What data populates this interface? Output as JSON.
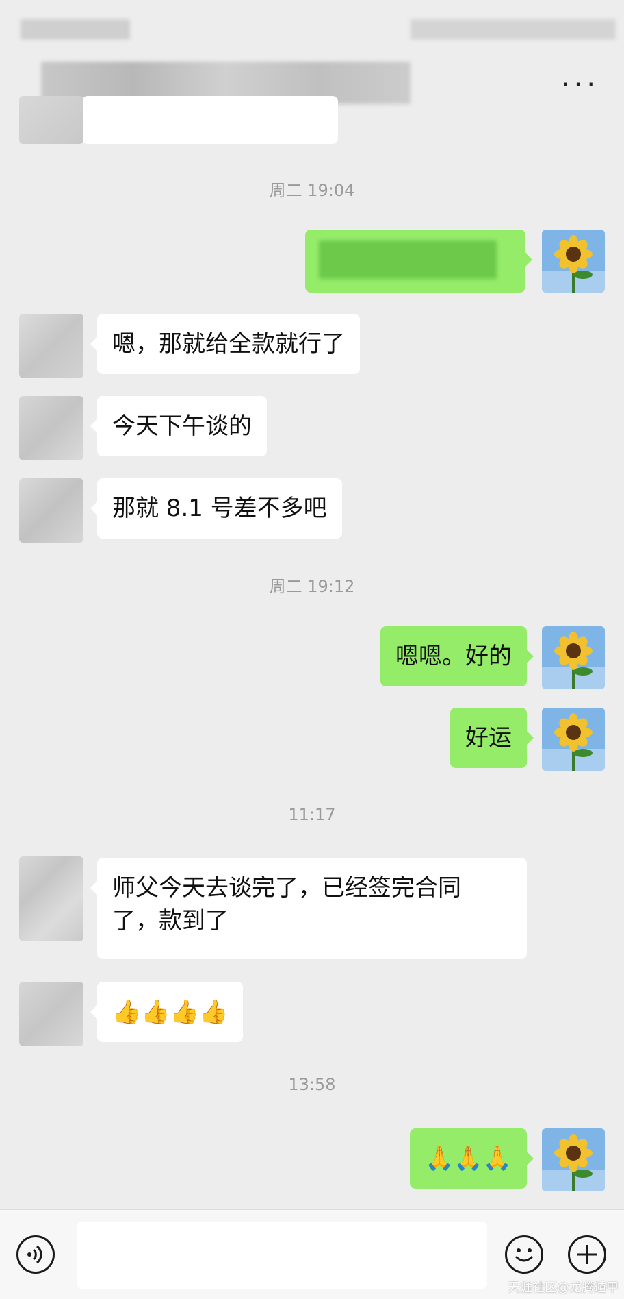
{
  "header": {
    "more_label": "···"
  },
  "timestamps": [
    "周二 19:04",
    "周二 19:12",
    "11:17",
    "13:58"
  ],
  "messages": [
    {
      "side": "in",
      "text": "嗯，那就给全款就行了"
    },
    {
      "side": "in",
      "text": "今天下午谈的"
    },
    {
      "side": "in",
      "text": "那就 8.1 号差不多吧"
    },
    {
      "side": "out",
      "text": "嗯嗯。好的"
    },
    {
      "side": "out",
      "text": "好运"
    },
    {
      "side": "in",
      "text": "师父今天去谈完了，已经签完合同\n了，款到了"
    },
    {
      "side": "in",
      "text": "👍👍👍👍"
    },
    {
      "side": "out",
      "text": "🙏🙏🙏"
    }
  ],
  "input": {
    "placeholder": ""
  },
  "colors": {
    "background": "#ededed",
    "incoming": "#ffffff",
    "outgoing": "#95ec69"
  },
  "icons": [
    "more-icon",
    "voice-icon",
    "emoji-icon",
    "plus-icon"
  ],
  "watermark": "天涯社区@龙腾遁甲"
}
